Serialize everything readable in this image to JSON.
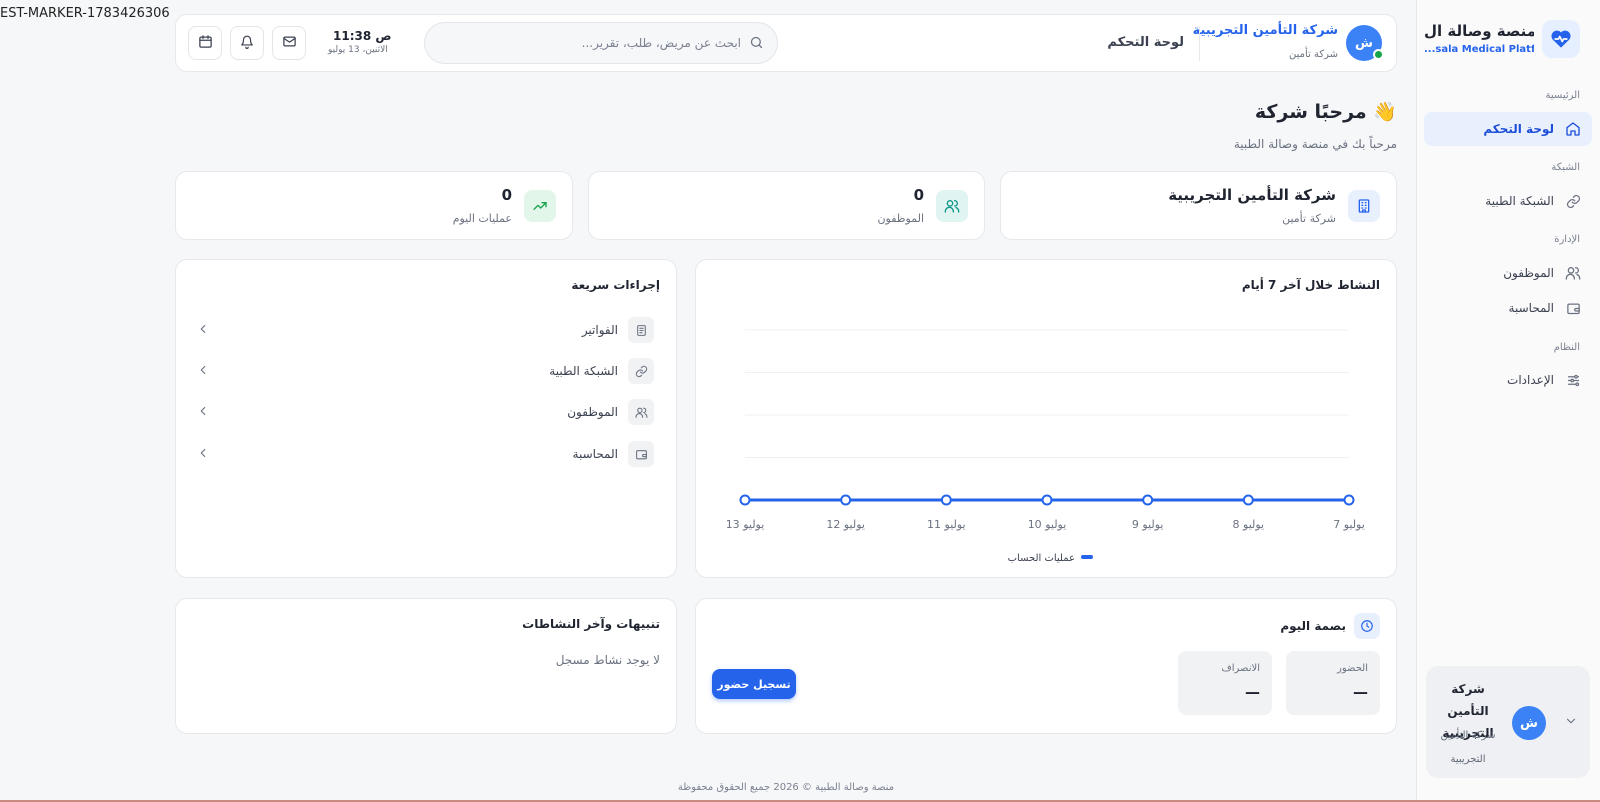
{
  "marker": "EST-MARKER-1783426306",
  "brand": {
    "name": "منصة وصالة ال...",
    "subtitle": "...sala Medical Platform"
  },
  "sidebar": {
    "sections": [
      {
        "label": "الرئيسية"
      },
      {
        "label": "الشبكة"
      },
      {
        "label": "الإدارة"
      },
      {
        "label": "النظام"
      }
    ],
    "items": [
      {
        "label": "لوحة التحكم",
        "icon": "home-icon",
        "active": true
      },
      {
        "label": "الشبكة الطبية",
        "icon": "link-icon"
      },
      {
        "label": "الموظفون",
        "icon": "users-icon"
      },
      {
        "label": "المحاسبة",
        "icon": "wallet-icon"
      },
      {
        "label": "الإعدادات",
        "icon": "sliders-icon"
      }
    ],
    "user_card": {
      "avatar": "ش",
      "name": "شركة التأمين التجريبية",
      "role": "شركة التأمين التجريبية"
    }
  },
  "header": {
    "avatar": "ش",
    "company": "شركة التأمين التجريبية",
    "role": "شركة تأمين",
    "title": "لوحة التحكم",
    "search_placeholder": "ابحث عن مريض، طلب، تقرير...",
    "time": "11:38 ص",
    "date": "الاثنين، 13 يوليو"
  },
  "welcome": {
    "title": "مرحبًا شركة",
    "emoji": "👋",
    "subtitle": "مرحباً بك في منصة وصالة الطبية"
  },
  "stats": [
    {
      "value": "شركة التأمين التجريبية",
      "label": "شركة تأمين",
      "icon": "building-icon"
    },
    {
      "value": "0",
      "label": "الموظفون",
      "icon": "users-icon"
    },
    {
      "value": "0",
      "label": "عمليات اليوم",
      "icon": "trending-up-icon"
    }
  ],
  "activity": {
    "title": "النشاط خلال آخر 7 أيام"
  },
  "chart_data": {
    "type": "line",
    "x": [
      "7 يوليو",
      "8 يوليو",
      "9 يوليو",
      "10 يوليو",
      "11 يوليو",
      "12 يوليو",
      "13 يوليو"
    ],
    "series": [
      {
        "name": "عمليات الحساب",
        "values": [
          0,
          0,
          0,
          0,
          0,
          0,
          0
        ],
        "color": "#2563eb"
      }
    ],
    "x_direction": "right-to-left",
    "grid": true,
    "legend": "bottom-center"
  },
  "quick_actions": {
    "title": "إجراءات سريعة",
    "items": [
      {
        "label": "الفواتير",
        "icon": "document-icon"
      },
      {
        "label": "الشبكة الطبية",
        "icon": "link-icon"
      },
      {
        "label": "الموظفون",
        "icon": "users-icon"
      },
      {
        "label": "المحاسبة",
        "icon": "wallet-icon"
      }
    ]
  },
  "attendance": {
    "title": "بصمة اليوم",
    "check_in_label": "الحضور",
    "check_in_value": "—",
    "check_out_label": "الانصراف",
    "check_out_value": "—",
    "button": "تسجيل حضور"
  },
  "notifications": {
    "title": "تنبيهات وآخر النشاطات",
    "empty": "لا يوجد نشاط مسجل"
  },
  "footer": "منصة وصالة الطبية © 2026 جميع الحقوق محفوظة",
  "colors": {
    "accent": "#2563eb",
    "online": "#16a34a",
    "teal": "#0d9488",
    "green": "#16a34a"
  }
}
